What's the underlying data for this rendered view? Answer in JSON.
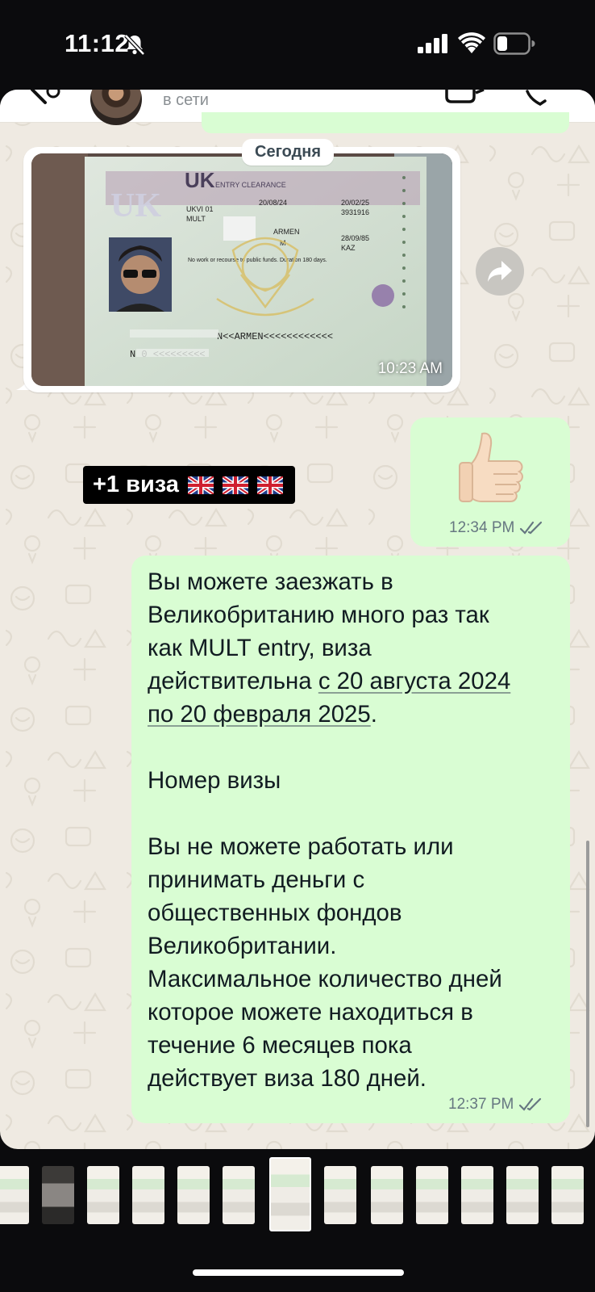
{
  "status_bar": {
    "time": "11:12",
    "icons": [
      "bell-slash-icon",
      "cellular-signal-icon",
      "wifi-icon",
      "battery-icon"
    ]
  },
  "header": {
    "contact_status": "в сети",
    "icons": [
      "back-arrow-icon",
      "avatar",
      "video-call-icon",
      "voice-call-icon"
    ]
  },
  "date_chip": "Сегодня",
  "messages": {
    "image": {
      "time": "10:23 AM",
      "photo": {
        "country_mark": "UK",
        "document_title": "ENTRY CLEARANCE",
        "fields": {
          "place": "UKVI 01",
          "type": "MULT",
          "valid_from": "20/08/24",
          "valid_until": "20/02/25",
          "number": "3931916",
          "birth_date": "28/09/85",
          "nationality": "KAZ",
          "sex": "M",
          "name_fragment": "ARMEN",
          "remarks": "No work or recourse to public funds. Duration 180 days."
        },
        "mrz_line_1": "N<<ARMEN<<<<<<<<<<<<",
        "mrz_line_2": "N  0    <<<<<<<<<"
      }
    },
    "sticker": {
      "text": "+1 виза",
      "flags": [
        "uk-flag-icon",
        "uk-flag-icon",
        "uk-flag-icon"
      ]
    },
    "thumbs_up": {
      "emoji": "thumbs-up-icon",
      "time": "12:34 PM",
      "status": "read-ticks-icon"
    },
    "text": {
      "lines_before_link": "Вы можете заезжать в\nВеликобританию много раз так\nкак MULT entry, виза\nдействительна ",
      "link_part_1": "с 20 августа 2024",
      "link_part_2": "по 20 февраля 2025",
      "lines_after_link": ".\n\nНомер визы\n\nВы не можете работать или\nпринимать деньги с\nобщественных фондов\nВеликобритании.\nМаксимальное количество дней\nкоторое можете находиться в\nтечение 6 месяцев пока\nдействует виза 180 дней.",
      "time": "12:37 PM",
      "status": "read-ticks-icon"
    }
  },
  "thumbnail_strip": {
    "count": 13,
    "selected_index": 6
  },
  "colors": {
    "outgoing_bubble": "#d9fdd3",
    "chat_background": "#efeae2",
    "read_ticks": "#667781"
  }
}
